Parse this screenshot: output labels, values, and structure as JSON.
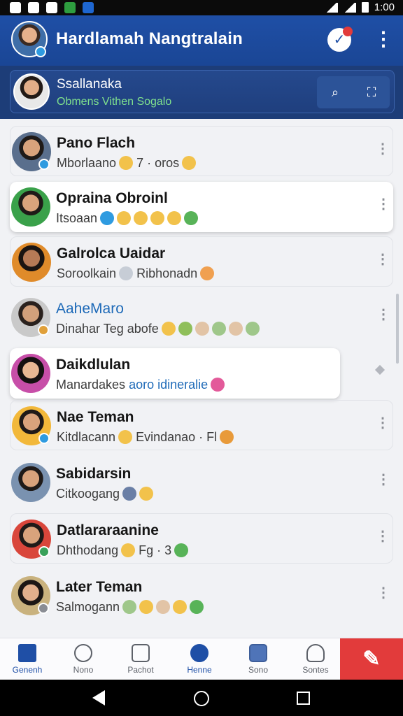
{
  "status_bar": {
    "time": "1:00"
  },
  "app_bar": {
    "title": "Hardlamah Nangtralain",
    "check_icon": "check-icon",
    "more_icon": "more-vertical-icon",
    "brand_color": "#1f4fa6"
  },
  "pinned": {
    "name": "Ssallanaka",
    "status": "Obmens Vithen Sogalo",
    "search_icon": "search-icon",
    "scan_icon": "scan-icon"
  },
  "conversations": [
    {
      "name": "Pano Flach",
      "message": "Mborlaano",
      "message_suffix": "7 · oros",
      "highlighted": false,
      "blue": false
    },
    {
      "name": "Opraina Obroinl",
      "message": "Itsoaan",
      "message_suffix": "",
      "highlighted": true,
      "blue": false
    },
    {
      "name": "Galrolca Uaidar",
      "message": "Soroolkain",
      "message_suffix": "Ribhonadn",
      "highlighted": false,
      "blue": false
    },
    {
      "name": "AaheMaro",
      "message": "Dinahar Teg abofe",
      "message_suffix": "",
      "highlighted": false,
      "blue": true
    },
    {
      "name": "Daikdlulan",
      "message": "Manardakes",
      "message_suffix": "aoro idineralie",
      "highlighted": true,
      "blue": false
    },
    {
      "name": "Nae Teman",
      "message": "Kitdlacann",
      "message_suffix": "Evindanao · Fl",
      "highlighted": false,
      "blue": false
    },
    {
      "name": "Sabidarsin",
      "message": "Citkoogang",
      "message_suffix": "",
      "highlighted": false,
      "blue": false
    },
    {
      "name": "Datlararaanine",
      "message": "Dhthodang",
      "message_suffix": "Fg · 3",
      "highlighted": false,
      "blue": false
    },
    {
      "name": "Later Teman",
      "message": "Salmogann",
      "message_suffix": "",
      "highlighted": false,
      "blue": false
    }
  ],
  "bottom_nav": [
    {
      "label": "Genenh",
      "icon": "home-icon",
      "active": true
    },
    {
      "label": "Nono",
      "icon": "location-icon",
      "active": false
    },
    {
      "label": "Pachot",
      "icon": "document-icon",
      "active": false
    },
    {
      "label": "Henne",
      "icon": "smile-icon",
      "active": false
    },
    {
      "label": "Sono",
      "icon": "folder-icon",
      "active": false
    },
    {
      "label": "Sontes",
      "icon": "person-icon",
      "active": false
    }
  ],
  "fab": {
    "icon": "compose-icon",
    "color": "#e23b3b"
  }
}
